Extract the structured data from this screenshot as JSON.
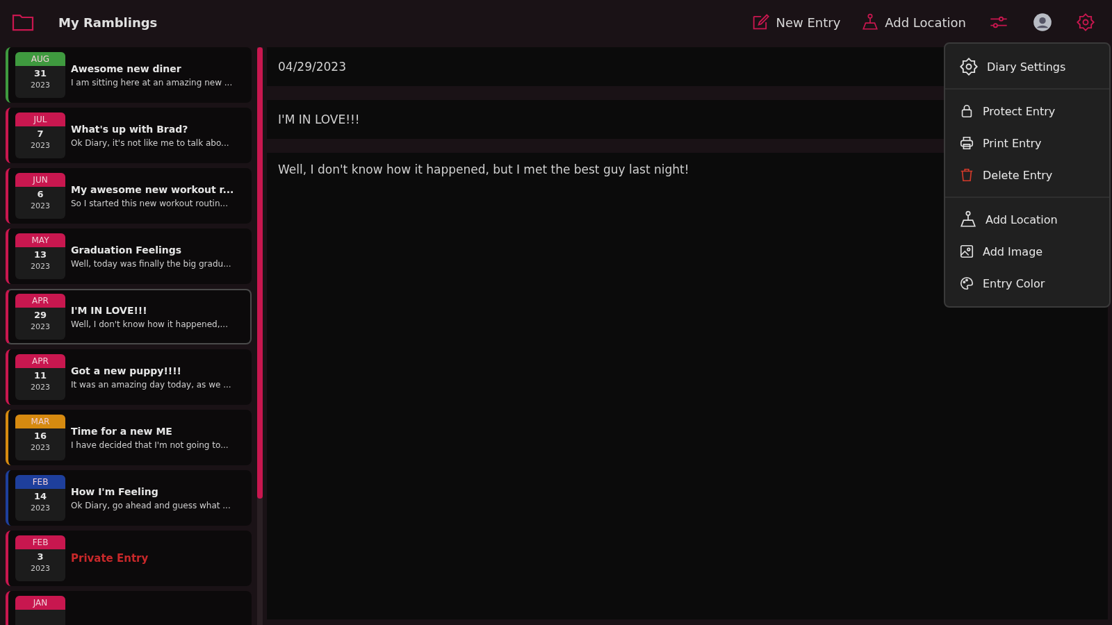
{
  "app": {
    "title": "My Ramblings"
  },
  "toolbar": [
    {
      "kind": "new",
      "label": "New Entry"
    },
    {
      "kind": "location",
      "label": "Add Location"
    },
    {
      "kind": "filters"
    },
    {
      "kind": "avatar"
    },
    {
      "kind": "settings"
    }
  ],
  "entries": [
    {
      "kind": "normal",
      "month": "AUG",
      "day": "31",
      "year": "2023",
      "title": "Awesome new diner",
      "preview": "I am sitting here at an amazing new ...",
      "color": "#3f9a3f",
      "selected": false
    },
    {
      "kind": "normal",
      "month": "JUL",
      "day": "7",
      "year": "2023",
      "title": "What's up with Brad?",
      "preview": "Ok Diary, it's not like me to talk abo...",
      "color": "#c8174f",
      "selected": false
    },
    {
      "kind": "normal",
      "month": "JUN",
      "day": "6",
      "year": "2023",
      "title": "My awesome new workout r...",
      "preview": "So I started this new workout routin...",
      "color": "#c8174f",
      "selected": false
    },
    {
      "kind": "normal",
      "month": "MAY",
      "day": "13",
      "year": "2023",
      "title": "Graduation Feelings",
      "preview": "Well, today was finally the big gradu...",
      "color": "#c8174f",
      "selected": false
    },
    {
      "kind": "normal",
      "month": "APR",
      "day": "29",
      "year": "2023",
      "title": "I'M IN LOVE!!!",
      "preview": "Well, I don't know how it happened,...",
      "color": "#c8174f",
      "selected": true
    },
    {
      "kind": "normal",
      "month": "APR",
      "day": "11",
      "year": "2023",
      "title": "Got a new puppy!!!!",
      "preview": "It was an amazing day today, as we ...",
      "color": "#c8174f",
      "selected": false
    },
    {
      "kind": "normal",
      "month": "MAR",
      "day": "16",
      "year": "2023",
      "title": "Time for a new ME",
      "preview": "I have decided that I'm not going to...",
      "color": "#d68a10",
      "selected": false
    },
    {
      "kind": "normal",
      "month": "FEB",
      "day": "14",
      "year": "2023",
      "title": "How I'm Feeling",
      "preview": "Ok Diary, go ahead and guess what ...",
      "color": "#1e3f9c",
      "selected": false
    },
    {
      "kind": "private",
      "month": "FEB",
      "day": "3",
      "year": "2023",
      "title": "Private Entry",
      "color": "#c8174f",
      "selected": false
    },
    {
      "kind": "normal",
      "month": "JAN",
      "color": "#c8174f",
      "selected": false
    }
  ],
  "editor": {
    "date": "04/29/2023",
    "title": "I'M IN LOVE!!!",
    "body": "Well, I don't know how it happened, but I met the best guy last night!"
  },
  "menu": [
    [
      {
        "kind": "settings",
        "label": "Diary Settings"
      }
    ],
    [
      {
        "kind": "lock",
        "label": "Protect Entry"
      },
      {
        "kind": "print",
        "label": "Print Entry"
      },
      {
        "kind": "delete",
        "label": "Delete Entry"
      }
    ],
    [
      {
        "kind": "location",
        "label": "Add Location"
      },
      {
        "kind": "image",
        "label": "Add Image"
      },
      {
        "kind": "color",
        "label": "Entry Color"
      }
    ]
  ]
}
